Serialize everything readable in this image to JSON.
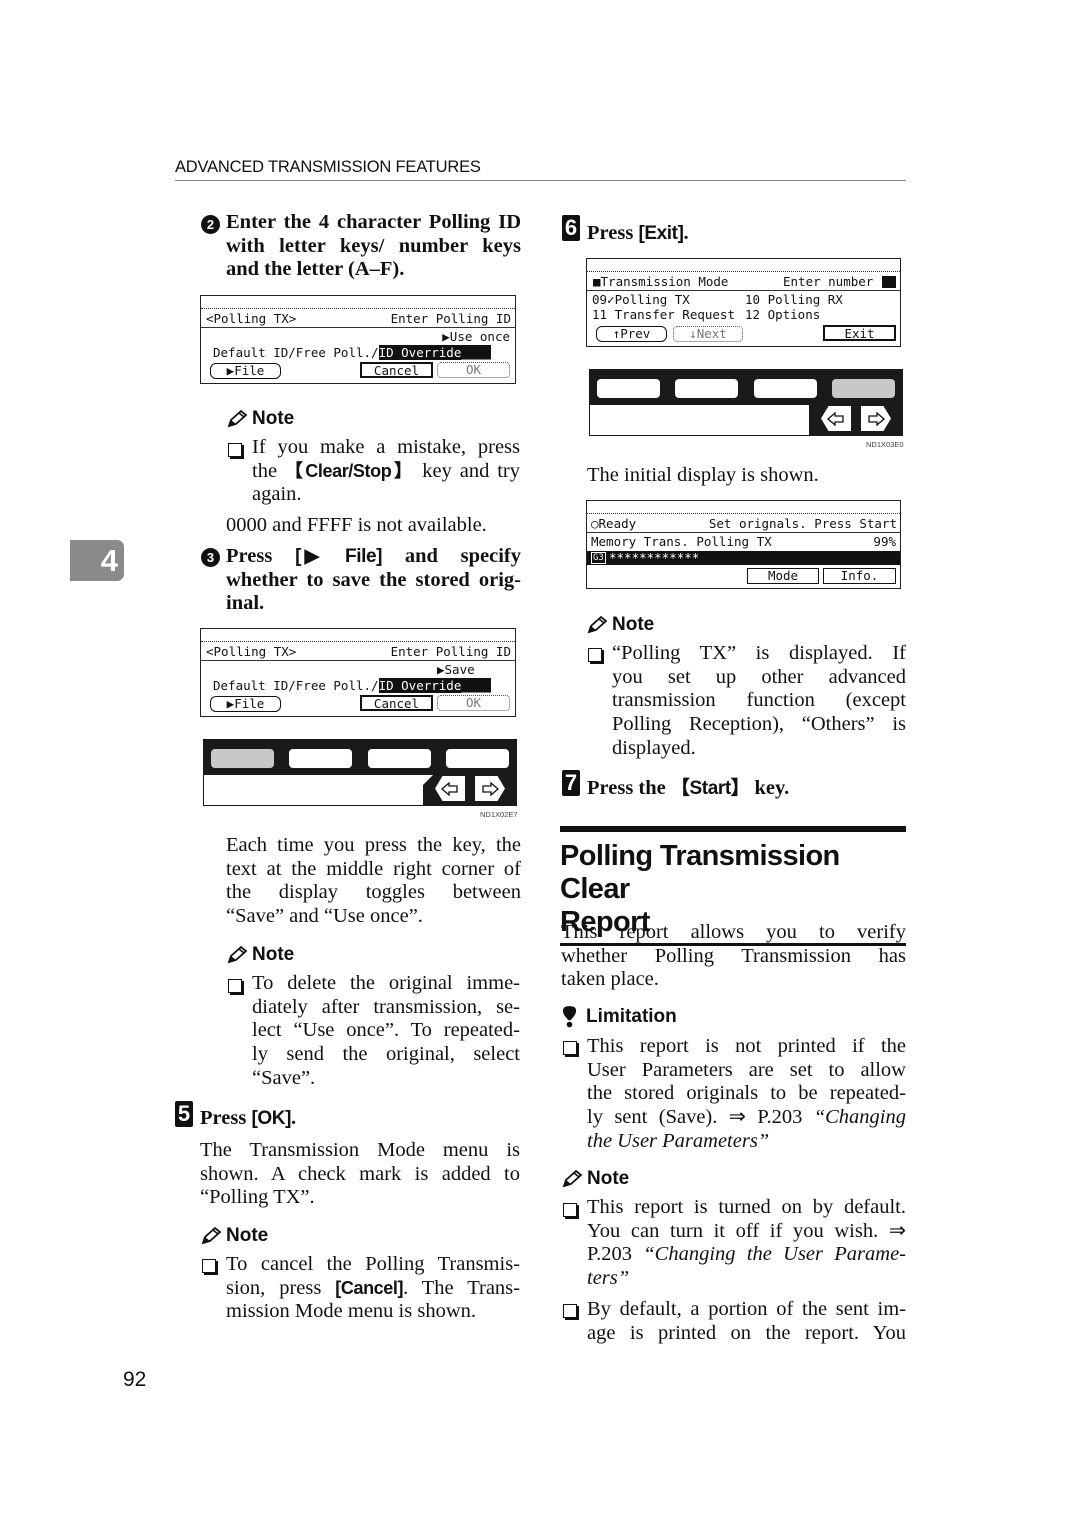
{
  "header": {
    "running_head": "ADVANCED TRANSMISSION FEATURES"
  },
  "chapter_tab": "4",
  "page_number": "92",
  "left": {
    "step2": {
      "num": "2",
      "lines": [
        "Enter the 4 character Polling ID",
        "with letter keys/ number keys",
        "and the letter (A–F)."
      ]
    },
    "lcd1": {
      "title_left": "<Polling TX>",
      "title_right": "Enter Polling ID",
      "toggle": "▶Use once",
      "line_prefix": "Default ID/Free Poll./",
      "line_highlight": "ID Override____",
      "btn_file": "▶File",
      "btn_cancel": "Cancel",
      "btn_ok": "OK"
    },
    "note1": {
      "heading": "Note",
      "item_line1": "If you make a mistake, press",
      "item_pre": "the ",
      "item_key": "【Clear/Stop】",
      "item_post": " key and try",
      "item_line3": "again."
    },
    "availability": "0000 and FFFF is not available.",
    "step3": {
      "num": "3",
      "pre": "Press ",
      "key": "[▶ File]",
      "post": " and specify",
      "line2": "whether to save the stored orig-",
      "line3": "inal."
    },
    "lcd2": {
      "title_left": "<Polling TX>",
      "title_right": "Enter Polling ID",
      "toggle": "▶Save",
      "line_prefix": "Default ID/Free Poll./",
      "line_highlight": "ID Override____",
      "btn_file": "▶File",
      "btn_cancel": "Cancel",
      "btn_ok": "OK"
    },
    "keypanel_fig_id": "ND1X02E7",
    "toggle_text": [
      "Each time you press the key, the",
      "text at the middle right corner of",
      "the display toggles between",
      "“Save” and “Use once”."
    ],
    "note2": {
      "heading": "Note",
      "lines": [
        "To delete the original imme-",
        "diately after transmission, se-",
        "lect “Use once”. To repeated-",
        "ly send the original, select",
        "“Save”."
      ]
    },
    "step5": {
      "num": "5",
      "pre": "Press ",
      "key": "[OK]",
      "post": ".",
      "body": [
        "The Transmission Mode menu is",
        "shown. A check mark is added to",
        "“Polling TX”."
      ]
    },
    "note3": {
      "heading": "Note",
      "line1": "To cancel the Polling Transmis-",
      "line2_pre": "sion, press ",
      "line2_key": "[Cancel]",
      "line2_post": ". The Trans-",
      "line3": "mission Mode menu is shown."
    }
  },
  "right": {
    "step6": {
      "num": "6",
      "pre": "Press ",
      "key": "[Exit]",
      "post": "."
    },
    "lcd3": {
      "title_left": "■Transmission Mode",
      "title_right": "Enter number",
      "row1_left": "09✓Polling TX",
      "row1_right": "10 Polling RX",
      "row2_left": "11 Transfer Request",
      "row2_right": "12 Options",
      "btn_prev": "↑Prev",
      "btn_next": "↓Next",
      "btn_exit": "Exit"
    },
    "keypanel_fig_id": "ND1X03E0",
    "initial_display": "The initial display is shown.",
    "lcd4": {
      "status": "○Ready",
      "instruction": "Set orignals. Press Start",
      "mode_line": "Memory Trans. Polling TX",
      "memory": "99%",
      "dest_tag": "G3",
      "dest_value": "************",
      "btn_mode": "Mode",
      "btn_info": "Info."
    },
    "note4": {
      "heading": "Note",
      "lines": [
        "“Polling TX” is displayed. If",
        "you set up other advanced",
        "transmission function (except",
        "Polling Reception), “Others” is",
        "displayed."
      ]
    },
    "step7": {
      "num": "7",
      "pre": "Press the ",
      "key": "【Start】",
      "post": " key."
    },
    "section": {
      "title_line1": "Polling Transmission Clear",
      "title_line2": "Report",
      "intro": [
        "This report allows you to verify",
        "whether Polling Transmission has",
        "taken place."
      ]
    },
    "limitation": {
      "heading": "Limitation",
      "lines": [
        "This report is not printed if the",
        "User Parameters are set to allow",
        "the stored originals to be repeated-"
      ],
      "line4_pre": "ly sent (Save). ⇒ P.203 ",
      "line4_ital": "“Changing",
      "line5_ital": "the User Parameters”"
    },
    "note5": {
      "heading": "Note",
      "item1_line1": "This report is turned on by default.",
      "item1_line2": "You can turn it off if you wish. ⇒",
      "item1_line3_pre": "P.203 ",
      "item1_line3_ital": "“Changing the User Parame-",
      "item1_line4_ital": "ters”",
      "item2_line1": "By default, a portion of the sent im-",
      "item2_line2": "age is printed on the report. You"
    }
  }
}
